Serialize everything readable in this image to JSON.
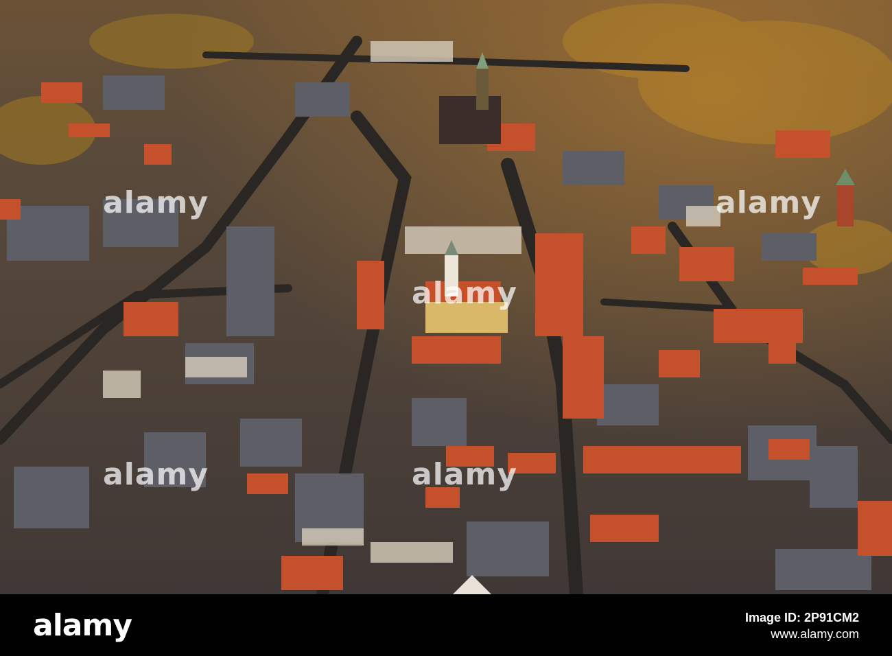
{
  "image": {
    "subject": "Aerial view of a historic town center at sunset with red-tiled roofs, a central town hall tower and a Gothic church spire"
  },
  "watermark": {
    "text": "alamy"
  },
  "footer": {
    "brand": "alamy",
    "image_id_label": "Image ID: 2P91CM2",
    "site": "www.alamy.com"
  },
  "colors": {
    "roof_red": "#c8502a",
    "roof_gray": "#5a5a62",
    "street": "#2e2a28",
    "foliage": "#8a6a2a",
    "footer_bg": "#000000"
  }
}
